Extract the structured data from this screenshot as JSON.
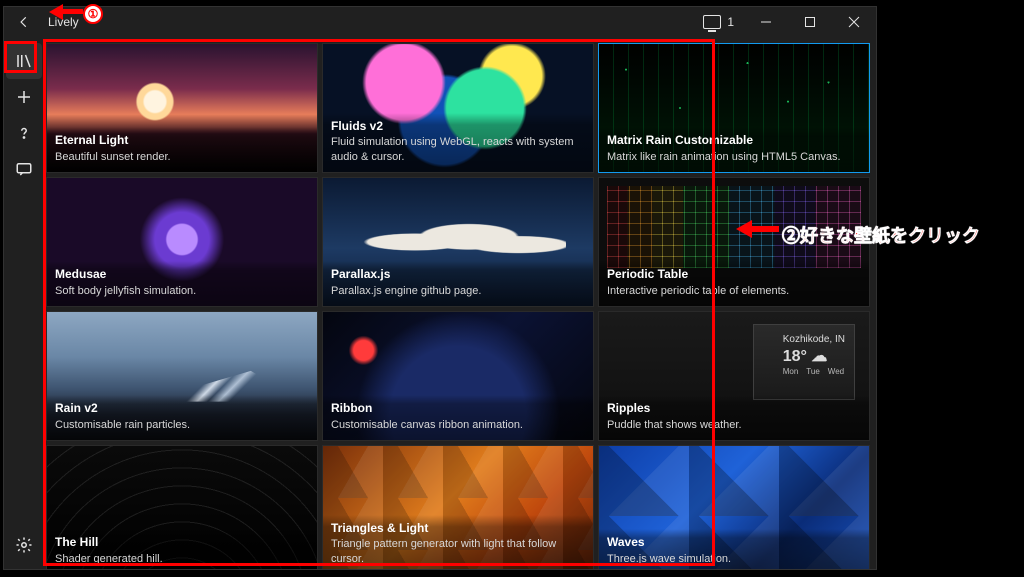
{
  "window": {
    "title": "Lively",
    "monitor_count": "1"
  },
  "annotations": {
    "step1_badge": "①",
    "step2_text": "②好きな壁紙をクリック"
  },
  "ripples_widget": {
    "place": "Kozhikode, IN",
    "temp": "18°",
    "day1": "Mon",
    "day2": "Tue",
    "day3": "Wed"
  },
  "tiles": [
    {
      "title": "Eternal Light",
      "desc": "Beautiful sunset render.",
      "thumb": "eternal",
      "selected": false
    },
    {
      "title": "Fluids v2",
      "desc": "Fluid simulation using WebGL, reacts with system audio & cursor.",
      "thumb": "fluids",
      "selected": false
    },
    {
      "title": "Matrix Rain Customizable",
      "desc": "Matrix like rain animation using HTML5 Canvas.",
      "thumb": "matrix",
      "selected": true
    },
    {
      "title": "Medusae",
      "desc": "Soft body jellyfish simulation.",
      "thumb": "medusae",
      "selected": false
    },
    {
      "title": "Parallax.js",
      "desc": "Parallax.js engine github page.",
      "thumb": "parallax",
      "selected": false
    },
    {
      "title": "Periodic Table",
      "desc": "Interactive periodic table of elements.",
      "thumb": "periodic",
      "selected": false
    },
    {
      "title": "Rain v2",
      "desc": "Customisable rain particles.",
      "thumb": "rain",
      "selected": false
    },
    {
      "title": "Ribbon",
      "desc": "Customisable canvas ribbon animation.",
      "thumb": "ribbon",
      "selected": false
    },
    {
      "title": "Ripples",
      "desc": "Puddle that shows weather.",
      "thumb": "ripples",
      "selected": false
    },
    {
      "title": "The Hill",
      "desc": "Shader generated hill.",
      "thumb": "hill",
      "selected": false
    },
    {
      "title": "Triangles & Light",
      "desc": "Triangle pattern generator with light that follow cursor.",
      "thumb": "triangles",
      "selected": false
    },
    {
      "title": "Waves",
      "desc": "Three.js wave simulation.",
      "thumb": "waves",
      "selected": false
    }
  ]
}
